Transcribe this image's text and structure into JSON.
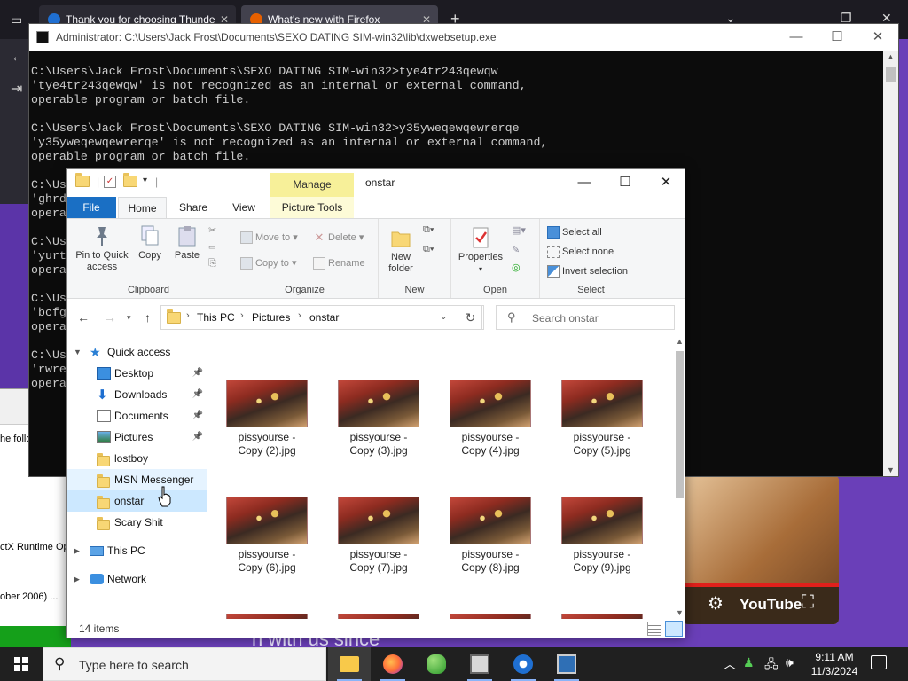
{
  "firefox": {
    "tabs": [
      {
        "label": "Thank you for choosing Thunde"
      },
      {
        "label": "What's new with Firefox"
      }
    ],
    "new_tab": "+"
  },
  "background": {
    "dialog_lines": [
      "he following act",
      "ctX Runtime Op",
      "ober 2006) ..."
    ],
    "bottom_text": "n with us since",
    "video": {
      "brand": "YouTube"
    }
  },
  "cmd": {
    "title": "Administrator: C:\\Users\\Jack Frost\\Documents\\SEXO DATING SIM-win32\\lib\\dxwebsetup.exe",
    "lines": [
      "C:\\Users\\Jack Frost\\Documents\\SEXO DATING SIM-win32>tye4tr243qewqw",
      "'tye4tr243qewqw' is not recognized as an internal or external command,",
      "operable program or batch file.",
      "",
      "C:\\Users\\Jack Frost\\Documents\\SEXO DATING SIM-win32>y35yweqewqewrerqe",
      "'y35yweqewqewrerqe' is not recognized as an internal or external command,",
      "operable program or batch file.",
      "",
      "C:\\Us",
      "'ghrd",
      "opera",
      "",
      "C:\\Us",
      "'yurt",
      "opera",
      "",
      "C:\\Us",
      "'bcfg",
      "opera",
      "",
      "C:\\Us",
      "'rwre",
      "opera"
    ]
  },
  "explorer": {
    "title": "onstar",
    "manage_label": "Manage",
    "tabs": {
      "file": "File",
      "home": "Home",
      "share": "Share",
      "view": "View",
      "picture_tools": "Picture Tools"
    },
    "ribbon": {
      "clipboard": {
        "label": "Clipboard",
        "pin": "Pin to Quick access",
        "copy": "Copy",
        "paste": "Paste"
      },
      "organize": {
        "label": "Organize",
        "move_to": "Move to",
        "copy_to": "Copy to",
        "delete": "Delete",
        "rename": "Rename"
      },
      "new": {
        "label": "New",
        "new_folder": "New folder"
      },
      "open": {
        "label": "Open",
        "properties": "Properties"
      },
      "select": {
        "label": "Select",
        "select_all": "Select all",
        "select_none": "Select none",
        "invert": "Invert selection"
      }
    },
    "address": {
      "crumbs": [
        "This PC",
        "Pictures",
        "onstar"
      ]
    },
    "search_placeholder": "Search onstar",
    "nav": {
      "quick_access": "Quick access",
      "items": [
        {
          "label": "Desktop",
          "pinned": true
        },
        {
          "label": "Downloads",
          "pinned": true
        },
        {
          "label": "Documents",
          "pinned": true
        },
        {
          "label": "Pictures",
          "pinned": true
        },
        {
          "label": "lostboy",
          "pinned": false
        },
        {
          "label": "MSN Messenger",
          "pinned": false
        },
        {
          "label": "onstar",
          "pinned": false
        },
        {
          "label": "Scary Shit",
          "pinned": false
        }
      ],
      "this_pc": "This PC",
      "network": "Network"
    },
    "files": [
      {
        "line1": "pissyourse -",
        "line2": "Copy (2).jpg"
      },
      {
        "line1": "pissyourse -",
        "line2": "Copy (3).jpg"
      },
      {
        "line1": "pissyourse -",
        "line2": "Copy (4).jpg"
      },
      {
        "line1": "pissyourse -",
        "line2": "Copy (5).jpg"
      },
      {
        "line1": "pissyourse -",
        "line2": "Copy (6).jpg"
      },
      {
        "line1": "pissyourse -",
        "line2": "Copy (7).jpg"
      },
      {
        "line1": "pissyourse -",
        "line2": "Copy (8).jpg"
      },
      {
        "line1": "pissyourse -",
        "line2": "Copy (9).jpg"
      }
    ],
    "status": "14 items"
  },
  "taskbar": {
    "search_placeholder": "Type here to search",
    "time": "9:11 AM",
    "date": "11/3/2024"
  }
}
